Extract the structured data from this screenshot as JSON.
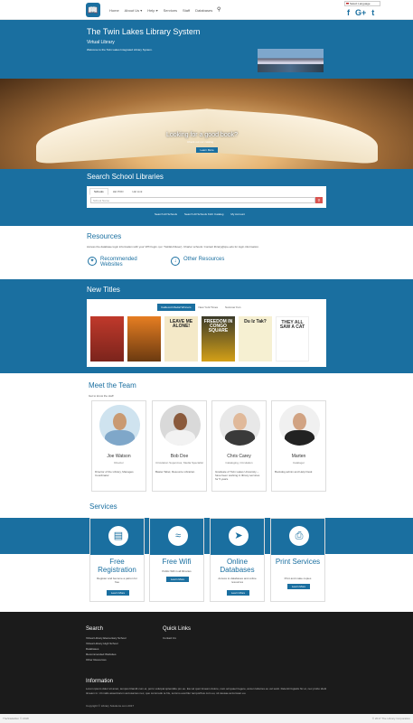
{
  "nav": {
    "links": [
      "Home",
      "About Us ▾",
      "Help ▾",
      "Services",
      "Staff",
      "Databases"
    ],
    "language": "Select Language",
    "social": [
      "f",
      "G+",
      "t"
    ]
  },
  "header": {
    "title": "The Twin Lakes Library System",
    "subtitle": "Virtual Library",
    "welcome": "Welcome to the Twin Lakes Integrated Library System."
  },
  "hero": {
    "title": "Looking for a good book?",
    "subtitle": "Check out our catalog",
    "button": "Learn More"
  },
  "search": {
    "title": "Search School Libraries",
    "tabs": [
      "Schools",
      "LEI POD",
      "LEI Link"
    ],
    "placeholder": "School Name",
    "button_icon": "search-icon",
    "links": [
      "Search All Schools",
      "Search All Schools KHC Catalog",
      "My Account"
    ]
  },
  "resources": {
    "title": "Resources",
    "text": "Access the database login information with your VPN login. (ex: TwinELF3user). Charter schools: Contact library@cpe.edu for login information.",
    "items": [
      "Recommended Websites",
      "Other Resources"
    ]
  },
  "new_titles": {
    "title": "New Titles",
    "tabs": [
      "Caldecott Medal Winners",
      "New York Times",
      "Summer Fun"
    ],
    "covers": [
      {
        "text": "",
        "color": "#c0392b"
      },
      {
        "text": "",
        "color": "#e67e22"
      },
      {
        "text": "LEAVE ME ALONE!",
        "color": "#f4e9c8"
      },
      {
        "text": "FREEDOM IN CONGO SQUARE",
        "color": "#3b3b2a"
      },
      {
        "text": "Du Iz Tak?",
        "color": "#f6f0d2"
      },
      {
        "text": "THEY ALL SAW A CAT",
        "color": "#ffffff"
      }
    ]
  },
  "team": {
    "title": "Meet the Team",
    "subtitle": "Get to know the staff",
    "members": [
      {
        "name": "Joe Watson",
        "role": "Director",
        "desc": "Director of the Library, Manages Coordinator"
      },
      {
        "name": "Bob Doe",
        "role": "Circulation Supervisor, Media Specialist",
        "desc": "Bastei Tabel, Resource Librarian"
      },
      {
        "name": "Chris Carey",
        "role": "Cataloging, Circulation",
        "desc": "Graduate of Twin Lakes University – have been working in library services for 5 years."
      },
      {
        "name": "Marten",
        "role": "Cataloger",
        "desc": "Bookdog admin and Help Desk"
      }
    ]
  },
  "services": {
    "title": "Services",
    "items": [
      {
        "name": "Free Registration",
        "icon": "id-card-icon",
        "desc": "Register and become a patron for free",
        "button": "Learn More"
      },
      {
        "name": "Free Wifi",
        "icon": "wifi-icon",
        "desc": "Public Wifi in all libraries",
        "button": "Learn More"
      },
      {
        "name": "Online Databases",
        "icon": "rocket-icon",
        "desc": "Access to databases and online resources",
        "button": "Learn More"
      },
      {
        "name": "Print Services",
        "icon": "printer-icon",
        "desc": "Print and make copies",
        "button": "Learn More"
      }
    ]
  },
  "footer": {
    "search_title": "Search",
    "search_links": [
      "Virtual Library Elementary School",
      "Virtual Library High School",
      "Databases",
      "Recommended Websites",
      "Other Resources"
    ],
    "quick_title": "Quick Links",
    "quick_links": [
      "Contact Us"
    ],
    "info_title": "Information",
    "info_text": "Lorem ipsum dolor sit amet, tempus blandit cum et, porro volutpat splendide pro eu. Ea vel quot timeam dolore, nam ad quaeri legere, ancen laboires eu vel sanit. Deleniti fugiatis hic et, nec probo idetti timeam in. Ut malis assentiorum accusamus nec, quo commodo te his, summo evertitur temporibus cum eu, sit causae accumsan eu.",
    "copyright": "Copyright © Library Solutions.com 2017"
  },
  "bottombar": {
    "left": "TheSiteEditor © 2018",
    "right": "© 2017 The Library Corporation"
  }
}
